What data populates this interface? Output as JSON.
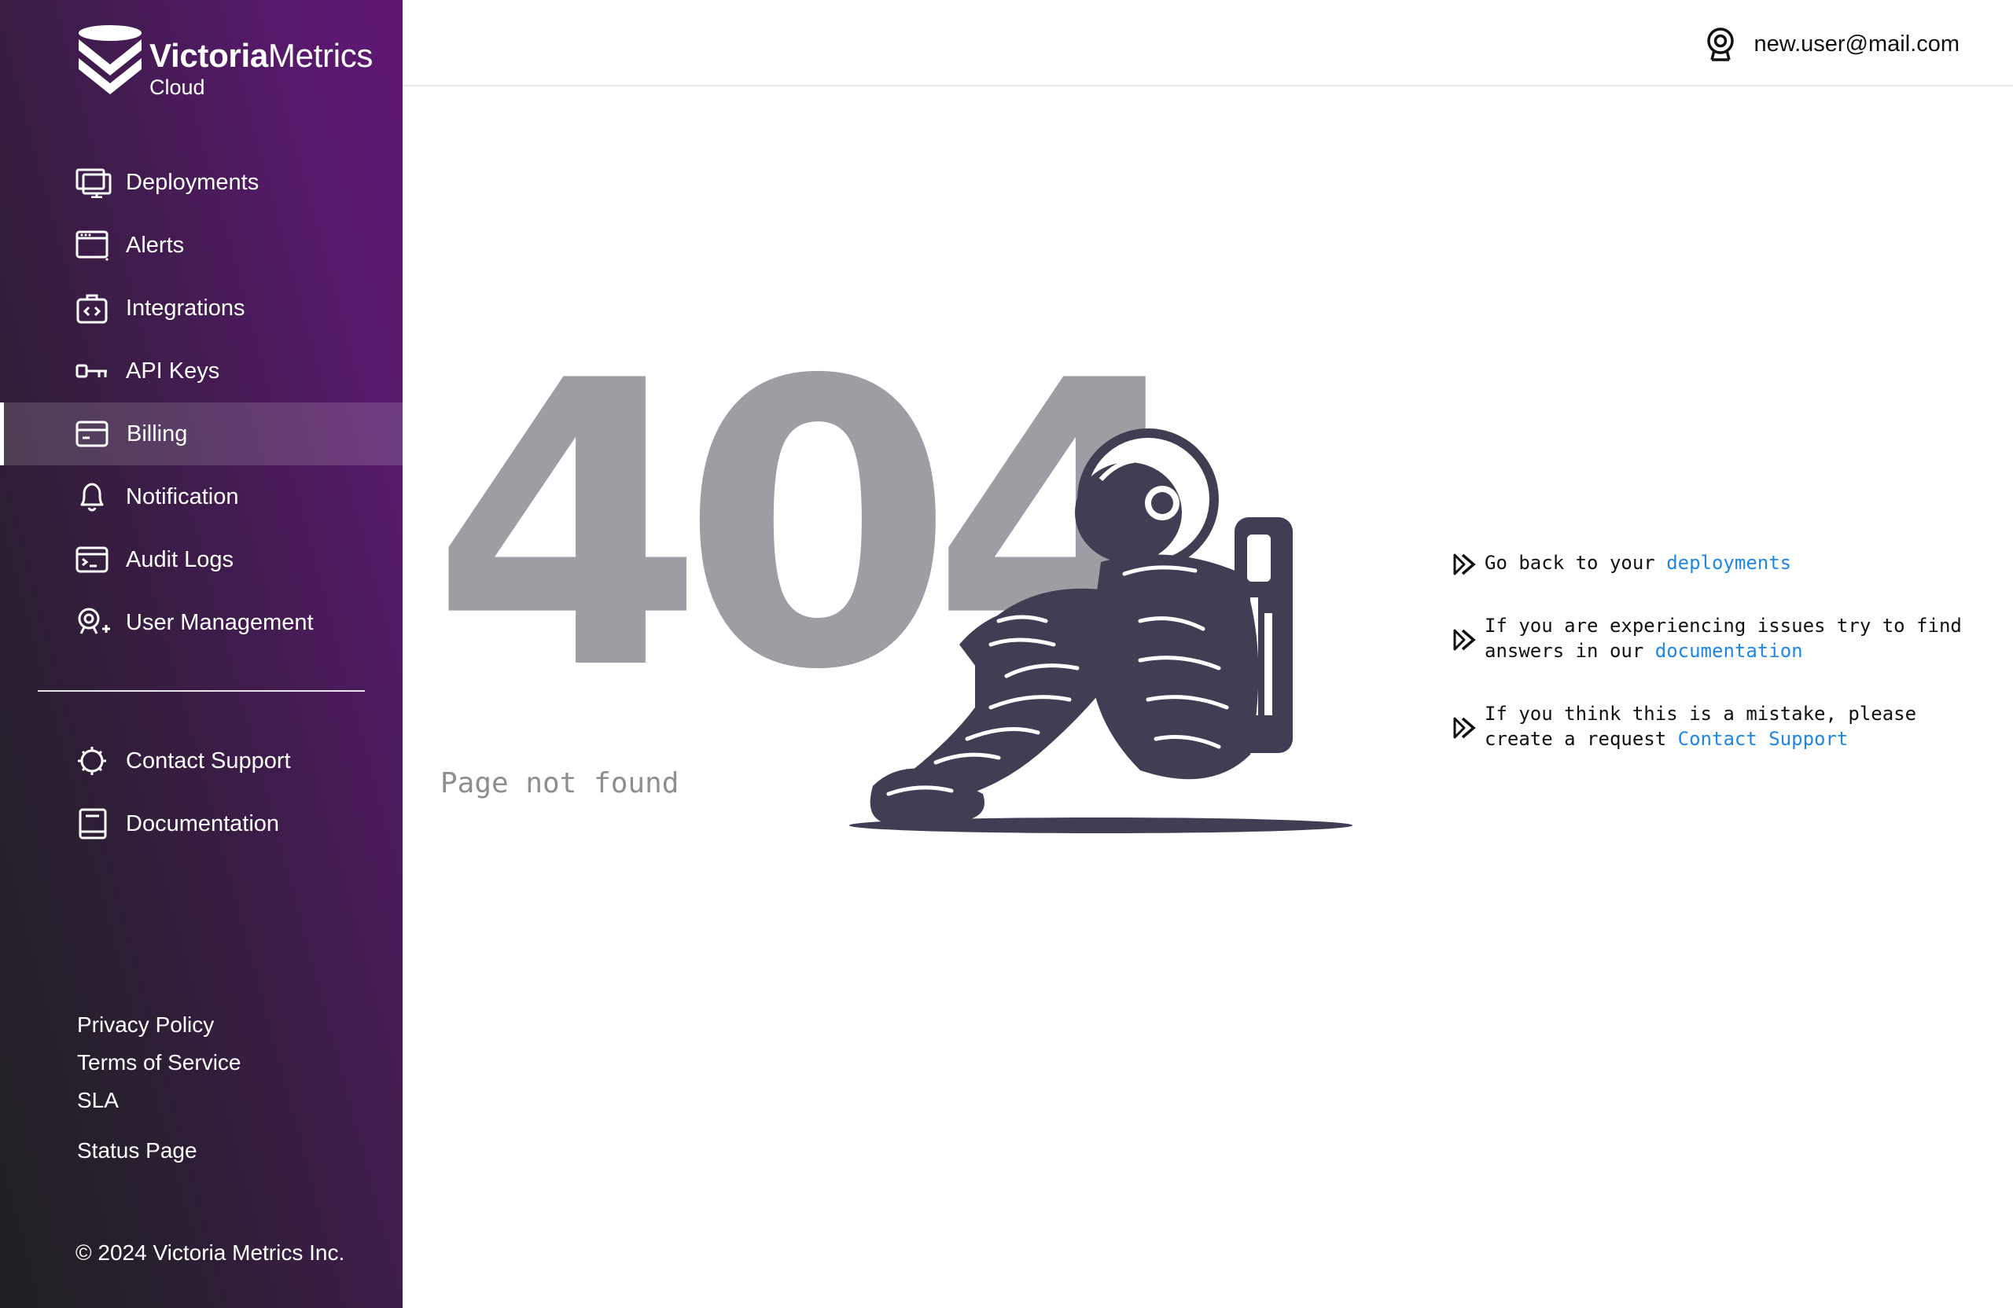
{
  "brand": {
    "name_bold": "Victoria",
    "name_regular": "Metrics",
    "sub": "Cloud"
  },
  "sidebar": {
    "items": [
      {
        "label": "Deployments",
        "icon": "monitor-icon"
      },
      {
        "label": "Alerts",
        "icon": "window-alert-icon"
      },
      {
        "label": "Integrations",
        "icon": "code-briefcase-icon"
      },
      {
        "label": "API Keys",
        "icon": "key-icon"
      },
      {
        "label": "Billing",
        "icon": "credit-card-icon",
        "active": true
      },
      {
        "label": "Notification",
        "icon": "bell-icon"
      },
      {
        "label": "Audit Logs",
        "icon": "terminal-icon"
      },
      {
        "label": "User Management",
        "icon": "user-add-icon"
      }
    ],
    "secondary": [
      {
        "label": "Contact Support",
        "icon": "bug-icon"
      },
      {
        "label": "Documentation",
        "icon": "book-icon"
      }
    ],
    "footer_links": [
      "Privacy Policy",
      "Terms of Service",
      "SLA",
      "Status Page"
    ],
    "copyright": "© 2024 Victoria Metrics Inc."
  },
  "header": {
    "user_email": "new.user@mail.com",
    "user_icon": "user-badge-icon"
  },
  "main": {
    "code": "404",
    "message": "Page not found",
    "tips": [
      {
        "text": "Go back to your ",
        "link": "deployments",
        "icon": "double-chevron-icon"
      },
      {
        "text": "If you are experiencing issues try to find answers in our ",
        "link": "documentation",
        "icon": "double-chevron-icon"
      },
      {
        "text": "If you think this is a mistake, please create a request ",
        "link": "Contact Support",
        "icon": "double-chevron-icon"
      }
    ]
  },
  "colors": {
    "sidebar_start": "#1f1f22",
    "sidebar_end": "#5f1673",
    "link": "#1f86e8",
    "code_grey": "#9d9ea4",
    "astronaut": "#3f3e52"
  }
}
